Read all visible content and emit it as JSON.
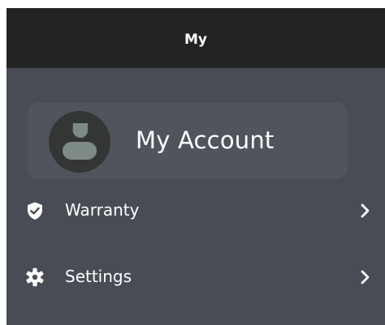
{
  "header": {
    "title": "My"
  },
  "account": {
    "label": "My Account",
    "avatar_icon": "user-avatar-icon"
  },
  "menu": {
    "items": [
      {
        "label": "Warranty",
        "icon": "shield-check-icon",
        "trailing_icon": "chevron-right-icon"
      },
      {
        "label": "Settings",
        "icon": "gear-icon",
        "trailing_icon": "chevron-right-icon"
      }
    ]
  },
  "colors": {
    "header_bg": "#222423",
    "content_bg": "#4a4c55",
    "card_bg": "#52545d",
    "avatar_bg": "#333635",
    "avatar_figure": "#7d8a88",
    "text": "#ffffff"
  }
}
